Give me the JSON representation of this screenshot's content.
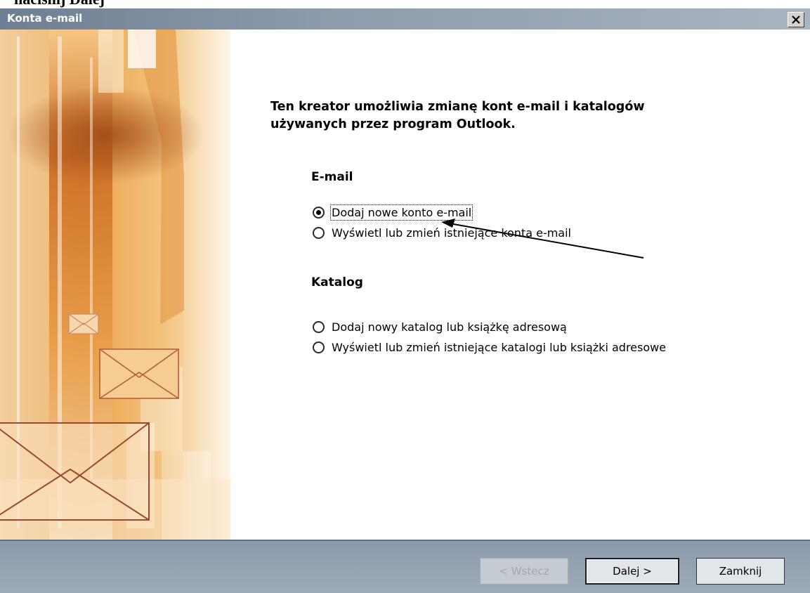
{
  "document_caption": "naciśnij Dalej",
  "window": {
    "title": "Konta e-mail",
    "close_glyph": "×"
  },
  "intro_text": "Ten kreator umożliwia zmianę kont e-mail i katalogów używanych przez program Outlook.",
  "email_section": {
    "title": "E-mail",
    "options": [
      {
        "label": "Dodaj nowe konto e-mail",
        "selected": true
      },
      {
        "label": "Wyświetl lub zmień istniejące konta e-mail",
        "selected": false
      }
    ]
  },
  "directory_section": {
    "title": "Katalog",
    "options": [
      {
        "label": "Dodaj nowy katalog lub książkę adresową",
        "selected": false
      },
      {
        "label": "Wyświetl lub zmień istniejące katalogi lub książki adresowe",
        "selected": false
      }
    ]
  },
  "buttons": {
    "back": "< Wstecz",
    "next": "Dalej >",
    "close": "Zamknij"
  },
  "colors": {
    "titlebar": "#7d8b9c",
    "footer": "#95a3b3",
    "sidebar_accent": "#e59b3a"
  },
  "icons": [
    "close-icon",
    "envelope-icon",
    "radio-selected",
    "radio-unselected",
    "annotation-arrow"
  ]
}
